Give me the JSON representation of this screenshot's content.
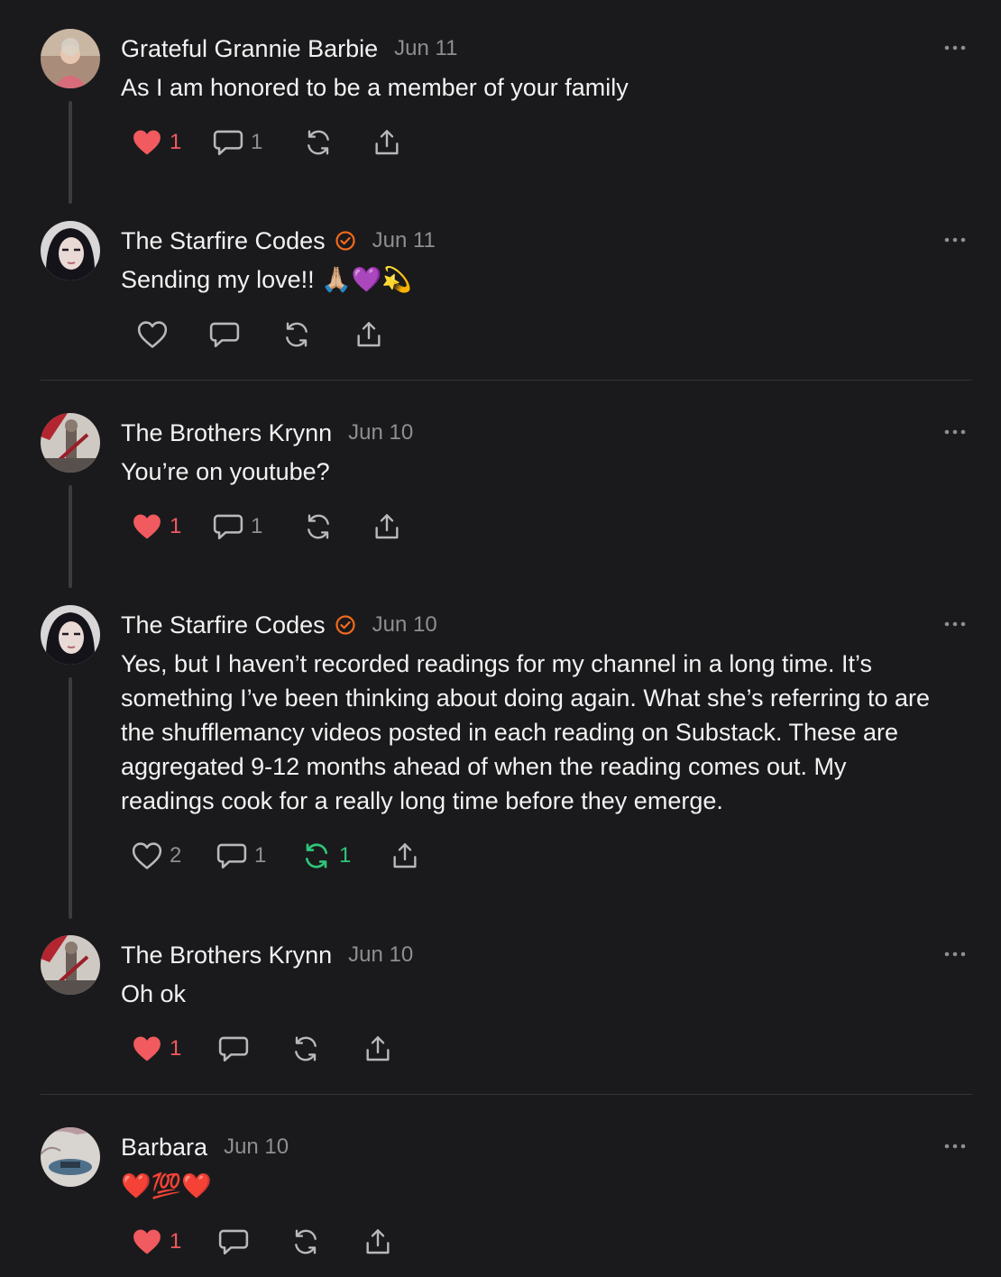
{
  "comments": [
    {
      "author": "Grateful Grannie Barbie",
      "date": "Jun 11",
      "verified": false,
      "text": [
        "As I am honored to be a member of your family"
      ],
      "likes": "1",
      "liked": true,
      "replies": "1",
      "restacks": "",
      "restacked": false
    },
    {
      "author": "The Starfire Codes",
      "date": "Jun 11",
      "verified": true,
      "text": [
        "Sending my love!! 🙏🏼💜💫"
      ],
      "likes": "",
      "liked": false,
      "replies": "",
      "restacks": "",
      "restacked": false
    },
    {
      "author": "The Brothers Krynn",
      "date": "Jun 10",
      "verified": false,
      "text": [
        "You’re on youtube?"
      ],
      "likes": "1",
      "liked": true,
      "replies": "1",
      "restacks": "",
      "restacked": false
    },
    {
      "author": "The Starfire Codes",
      "date": "Jun 10",
      "verified": true,
      "text": [
        "Yes, but I haven’t recorded readings for my channel in a long time. It’s",
        "something I’ve been thinking about doing again. What she’s referring to are",
        "the shufflemancy videos posted in each reading on Substack. These are",
        "aggregated 9-12 months ahead of when the reading comes out. My",
        "readings cook for a really long time before they emerge."
      ],
      "likes": "2",
      "liked": false,
      "replies": "1",
      "restacks": "1",
      "restacked": true
    },
    {
      "author": "The Brothers Krynn",
      "date": "Jun 10",
      "verified": false,
      "text": [
        "Oh ok"
      ],
      "likes": "1",
      "liked": true,
      "replies": "",
      "restacks": "",
      "restacked": false
    },
    {
      "author": "Barbara",
      "date": "Jun 10",
      "verified": false,
      "text": [
        "❤️💯❤️"
      ],
      "likes": "1",
      "liked": true,
      "replies": "",
      "restacks": "",
      "restacked": false
    }
  ],
  "icons": {
    "like": "heart-icon",
    "reply": "comment-bubble-icon",
    "restack": "restack-icon",
    "share": "share-icon",
    "more": "more-options-icon",
    "verified": "verified-check-icon"
  },
  "colors": {
    "background": "#1a1a1c",
    "text": "#f2f2f2",
    "muted": "#8e8e93",
    "liked": "#f15a5f",
    "restacked": "#2fc57a",
    "verified": "#f26a1b",
    "divider": "#343438"
  }
}
